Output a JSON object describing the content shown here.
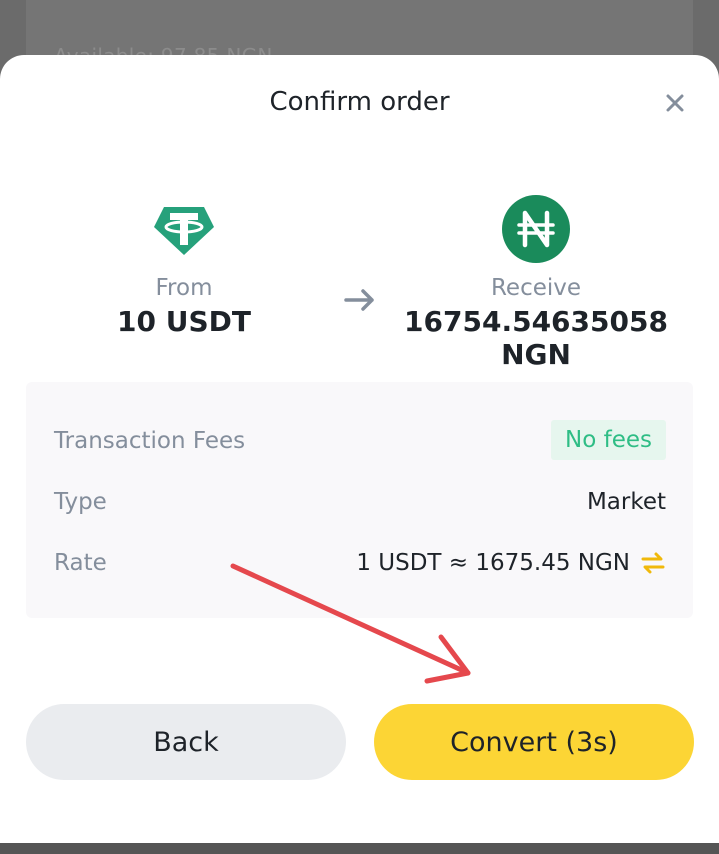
{
  "background": {
    "available_text": "Available: 97.85 NGN"
  },
  "dialog": {
    "title": "Confirm order",
    "close_icon": "close-icon"
  },
  "from": {
    "label": "From",
    "amount": "10 USDT",
    "icon": "usdt-coin-icon",
    "color": "#26a17b"
  },
  "to": {
    "label": "Receive",
    "amount": "16754.54635058 NGN",
    "icon": "ngn-coin-icon",
    "symbol": "₦",
    "color": "#1a8b5b"
  },
  "details": {
    "fees_label": "Transaction Fees",
    "fees_value": "No fees",
    "type_label": "Type",
    "type_value": "Market",
    "rate_label": "Rate",
    "rate_value": "1 USDT ≈ 1675.45 NGN"
  },
  "actions": {
    "back_label": "Back",
    "convert_label": "Convert (3s)"
  },
  "colors": {
    "accent_yellow": "#fcd535",
    "secondary_button": "#eaecef",
    "positive_green": "#2ebd85",
    "annotation_red": "#e5484d"
  }
}
